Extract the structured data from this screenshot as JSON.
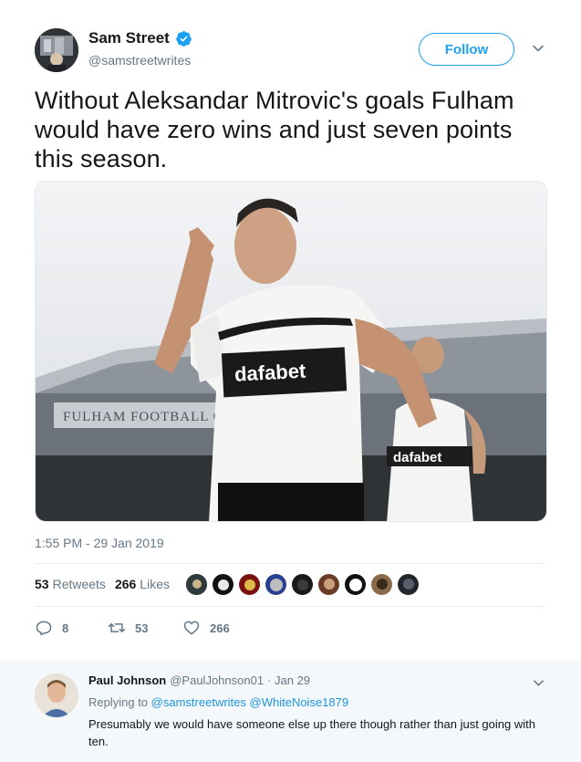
{
  "tweet": {
    "display_name": "Sam Street",
    "handle": "@samstreetwrites",
    "follow_label": "Follow",
    "text": "Without Aleksandar Mitrovic's goals Fulham would have zero wins and just seven points this season.",
    "timestamp": "1:55 PM - 29 Jan 2019",
    "retweets_count": "53",
    "retweets_label": "Retweets",
    "likes_count": "266",
    "likes_label": "Likes",
    "replies_action": "8",
    "retweets_action": "53",
    "likes_action": "266",
    "media_sign": "FULHAM FOOTBALL C",
    "media_sponsor": "dafabet"
  },
  "reply": {
    "display_name": "Paul Johnson",
    "handle": "@PaulJohnson01",
    "date": "· Jan 29",
    "replying_label": "Replying to",
    "mention_1": "@samstreetwrites",
    "mention_2": "@WhiteNoise1879",
    "text": "Presumably we would have someone else up there though rather than just going with ten."
  },
  "colors": {
    "accent": "#1da1f2",
    "link": "#1b95e0",
    "muted": "#657786",
    "text": "#14171a"
  },
  "icons": [
    "verified-badge-icon",
    "chevron-down-icon",
    "reply-icon",
    "retweet-icon",
    "heart-icon"
  ]
}
